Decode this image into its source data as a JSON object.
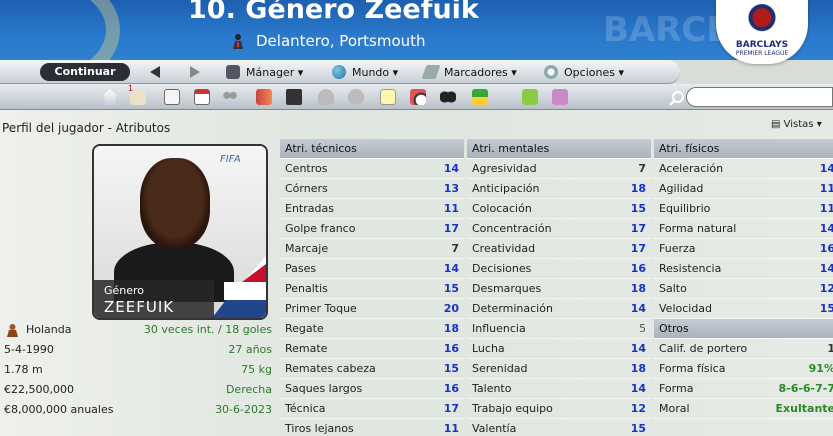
{
  "header": {
    "title": "10. Género Zeefuik",
    "subtitle": "Delantero, Portsmouth",
    "league": "BARCLAYS",
    "league_sub": "PREMIER LEAGUE",
    "bg_text": "BARCLAYS"
  },
  "toolbar": {
    "continue_label": "Continuar",
    "menus": [
      "Mánager",
      "Mundo",
      "Marcadores",
      "Opciones"
    ],
    "badge": "1"
  },
  "page": {
    "breadcrumb": "Perfil del jugador - Atributos",
    "views_label": "Vistas"
  },
  "card": {
    "first_name": "Género",
    "last_name": "ZEEFUIK"
  },
  "info": [
    {
      "left": "Holanda",
      "right": "30 veces int. / 18 goles"
    },
    {
      "left": "5-4-1990",
      "right": "27 años"
    },
    {
      "left": "1.78 m",
      "right": "75 kg"
    },
    {
      "left": "€22,500,000",
      "right": "Derecha"
    },
    {
      "left": "€8,000,000 anuales",
      "right": "30-6-2023"
    }
  ],
  "technical": {
    "title": "Atri. técnicos",
    "rows": [
      {
        "name": "Centros",
        "value": "14"
      },
      {
        "name": "Córners",
        "value": "13"
      },
      {
        "name": "Entradas",
        "value": "11"
      },
      {
        "name": "Golpe franco",
        "value": "17"
      },
      {
        "name": "Marcaje",
        "value": "7"
      },
      {
        "name": "Pases",
        "value": "14"
      },
      {
        "name": "Penaltis",
        "value": "15"
      },
      {
        "name": "Primer Toque",
        "value": "20"
      },
      {
        "name": "Regate",
        "value": "18"
      },
      {
        "name": "Remate",
        "value": "16"
      },
      {
        "name": "Remates cabeza",
        "value": "15"
      },
      {
        "name": "Saques largos",
        "value": "16"
      },
      {
        "name": "Técnica",
        "value": "17"
      },
      {
        "name": "Tiros lejanos",
        "value": "11"
      }
    ]
  },
  "mental": {
    "title": "Atri. mentales",
    "rows": [
      {
        "name": "Agresividad",
        "value": "7"
      },
      {
        "name": "Anticipación",
        "value": "18"
      },
      {
        "name": "Colocación",
        "value": "15"
      },
      {
        "name": "Concentración",
        "value": "17"
      },
      {
        "name": "Creatividad",
        "value": "17"
      },
      {
        "name": "Decisiones",
        "value": "16"
      },
      {
        "name": "Desmarques",
        "value": "18"
      },
      {
        "name": "Determinación",
        "value": "14"
      },
      {
        "name": "Influencia",
        "value": "5"
      },
      {
        "name": "Lucha",
        "value": "14"
      },
      {
        "name": "Serenidad",
        "value": "18"
      },
      {
        "name": "Talento",
        "value": "14"
      },
      {
        "name": "Trabajo equipo",
        "value": "12"
      },
      {
        "name": "Valentía",
        "value": "15"
      }
    ]
  },
  "physical": {
    "title": "Atri. físicos",
    "rows": [
      {
        "name": "Aceleración",
        "value": "14"
      },
      {
        "name": "Agilidad",
        "value": "11"
      },
      {
        "name": "Equilibrio",
        "value": "11"
      },
      {
        "name": "Forma natural",
        "value": "14"
      },
      {
        "name": "Fuerza",
        "value": "16"
      },
      {
        "name": "Resistencia",
        "value": "14"
      },
      {
        "name": "Salto",
        "value": "12"
      },
      {
        "name": "Velocidad",
        "value": "15"
      }
    ]
  },
  "others": {
    "title": "Otros",
    "rows": [
      {
        "name": "Calif. de portero",
        "value": "1"
      },
      {
        "name": "Forma física",
        "value": "91%"
      },
      {
        "name": "Forma",
        "value": "8-6-6-7-7"
      },
      {
        "name": "Moral",
        "value": "Exultante"
      }
    ]
  }
}
